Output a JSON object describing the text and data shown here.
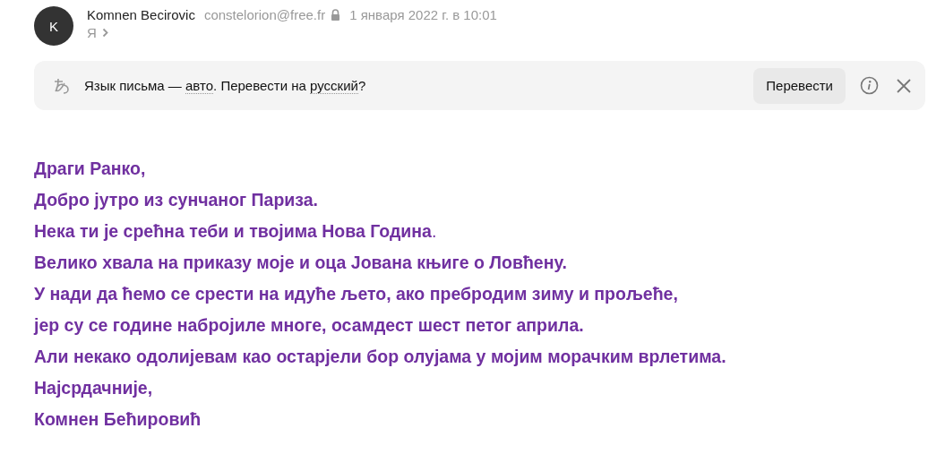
{
  "sender": {
    "avatar_letter": "K",
    "name": "Komnen Becirovic",
    "email": "constelorion@free.fr",
    "date": "1 января 2022 г. в 10:01",
    "recipient": "Я"
  },
  "translate_bar": {
    "parts": [
      {
        "kind": "text",
        "text": "Язык письма — "
      },
      {
        "kind": "link",
        "text": "авто"
      },
      {
        "kind": "text",
        "text": ". Перевести на "
      },
      {
        "kind": "link",
        "text": "русский"
      },
      {
        "kind": "text",
        "text": "?"
      }
    ],
    "button": "Перевести"
  },
  "body": {
    "lines": [
      {
        "text": "Драги Ранко,"
      },
      {
        "text": "Добро јутро из сунчаног Париза."
      },
      {
        "text": "Нека ти је срећна теби и твојима Нова Година",
        "tail": "."
      },
      {
        "text": "Велико хвала на приказу моје и оца Јована књиге о Ловћену."
      },
      {
        "text": "У нади да ћемо се срести на идуће љето, ако пребродим зиму и прољеће,"
      },
      {
        "text": "јер су се године набројиле многе, осамдест шест петог априла."
      },
      {
        "text": "Али  некако одолијевам као остарјели бор олујама у мојим морачким врлетима."
      },
      {
        "text": "Најсрдачније,"
      },
      {
        "text": "Комнен Бећировић"
      }
    ]
  }
}
